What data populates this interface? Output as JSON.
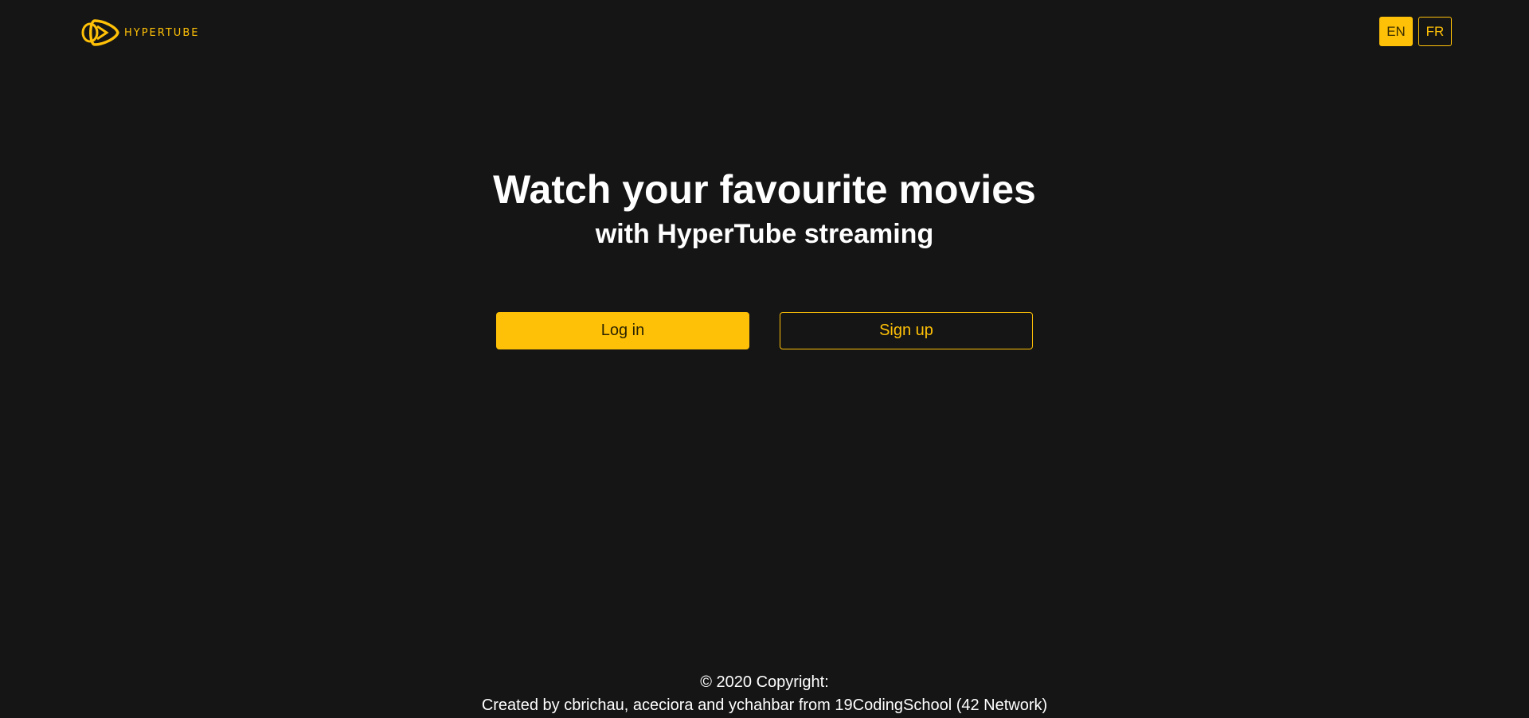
{
  "header": {
    "logo_text": "HYPERTUBE",
    "languages": [
      {
        "label": "EN",
        "active": true
      },
      {
        "label": "FR",
        "active": false
      }
    ]
  },
  "hero": {
    "title": "Watch your favourite movies",
    "subtitle": "with HyperTube streaming"
  },
  "actions": {
    "login_label": "Log in",
    "signup_label": "Sign up"
  },
  "footer": {
    "copyright": "© 2020 Copyright:",
    "credits": "Created by cbrichau, aceciora and ychahbar from 19CodingSchool (42 Network)"
  },
  "colors": {
    "background": "#151515",
    "accent": "#ffc107",
    "text": "#ffffff"
  }
}
